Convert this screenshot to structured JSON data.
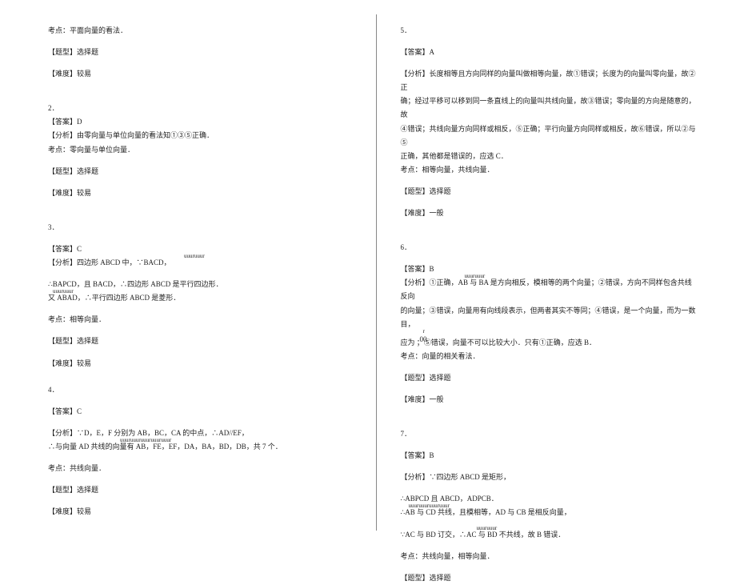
{
  "left": {
    "q1": {
      "kaodian": "考点：平面向量的看法．",
      "tixing": "【题型】选择题",
      "nandu": "【难度】较易"
    },
    "q2": {
      "num": "2．",
      "ans": "【答案】D",
      "fenxi": "【分析】由零向量与单位向量的看法知①③⑤正确．",
      "kaodian": "考点：零向量与单位向量．",
      "tixing": "【题型】选择题",
      "nandu": "【难度】较易"
    },
    "q3": {
      "num": "3．",
      "ans": "【答案】C",
      "fenxi_a": "【分析】四边形 ABCD 中，∵BACD，",
      "sup_a": "uuuruuur",
      "line_b": "∴BAPCD，且 BACD，∴四边形 ABCD 是平行四边形．",
      "line_c_sup": "uuuruuur",
      "line_c": "又 ABAD，∴平行四边形 ABCD 是菱形．",
      "kaodian": "考点：相等向量．",
      "tixing": "【题型】选择题",
      "nandu": "【难度】较易"
    },
    "q4": {
      "num": "4．",
      "ans": "【答案】C",
      "fenxi_a": "【分析】∵D，E，F 分别为 AB，BC，CA 的中点，∴AD//EF，",
      "sup_a": "uuuruuuruuuruuuruuur",
      "line_b": "∴与向量 AD 共线的向量有 AB，FE，EF，DA，BA，BD，DB，共 7 个．",
      "kaodian": "考点：共线向量．",
      "tixing": "【题型】选择题",
      "nandu": "【难度】较易"
    }
  },
  "right": {
    "q5": {
      "num": "5．",
      "ans": "【答案】A",
      "fenxi_a": "【分析】长度相等且方向同样的向量叫做相等向量，故①错误；长度为的向量叫零向量，故②正",
      "fenxi_b": "确；经过平移可以移到同一条直线上的向量叫共线向量，故③错误；零向量的方向是随意的，故",
      "fenxi_c": "④错误；共线向量方向同样或相反，⑤正确；平行向量方向同样或相反，故⑥错误，所以②与⑤",
      "fenxi_d": "正确，其他都是错误的，应选 C．",
      "kaodian": "考点：相等向量，共线向量．",
      "tixing": "【题型】选择题",
      "nandu": "【难度】一般"
    },
    "q6": {
      "num": "6．",
      "ans": "【答案】B",
      "sup_a": "uuuruuur",
      "fenxi_a": "【分析】①正确，AB 与 BA 是方向相反，模相等的两个向量；②错误，方向不同样包含共线反向",
      "line_b": "的向量；③错误，向量用有向线段表示，但两者其实不等同；④错误，是一个向量，而为一数目，",
      "line_c_sup": "r",
      "line_c_mid": "00",
      "line_c": "应为       ；⑤错误，向量不可以比较大小．只有①正确，应选 B．",
      "kaodian": "考点：向量的相关看法．",
      "tixing": "【题型】选择题",
      "nandu": "【难度】一般"
    },
    "q7": {
      "num": "7．",
      "ans": "【答案】B",
      "fenxi_a": "【分析】∵四边形 ABCD 是矩形，",
      "line_b": "∴ABPCD 且 ABCD，ADPCB．",
      "sup_c": "uuuruuuruuuruuur",
      "line_c": "∴AB 与 CD 共线，且模相等，AD 与 CB 是相反向量，",
      "sup_d": "uuuruuur",
      "line_d": "∵AC 与 BD 订交，∴AC 与 BD 不共线，故 B 错误．",
      "kaodian": "考点：共线向量，相等向量．",
      "tixing": "【题型】选择题"
    }
  }
}
